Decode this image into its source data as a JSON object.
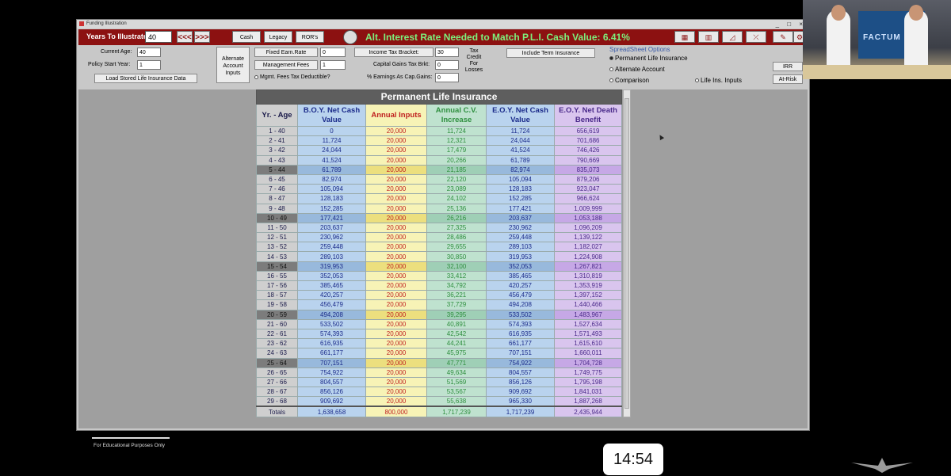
{
  "window": {
    "title": "Funding Illustration",
    "controls": "_ □ ×"
  },
  "topbar": {
    "years_label": "Years To Illustrate:",
    "years_value": "40",
    "prev_label": "<<<",
    "next_label": ">>>",
    "cash_label": "Cash",
    "legacy_label": "Legacy",
    "rors_label": "ROR's",
    "alt_rate_text": "Alt. Interest Rate Needed to Match P.L.I. Cash Value: 6.41%"
  },
  "inputs": {
    "current_age_label": "Current Age:",
    "current_age": "40",
    "policy_start_label": "Policy Start Year:",
    "policy_start": "1",
    "load_button": "Load Stored Life Insurance Data",
    "alt_inputs_button": "Alternate Account Inputs",
    "fixed_rate_label": "Fixed Earn.Rate",
    "fixed_rate": "0",
    "mgmt_fees_label": "Management Fees",
    "mgmt_fees": "1",
    "mgmt_tax_label": "Mgmt. Fees Tax Deductible?",
    "income_tax_label": "Income Tax Bracket:",
    "income_tax": "30",
    "cap_gains_label": "Capital Gains Tax Brkt:",
    "cap_gains": "0",
    "earnings_cap_label": "% Earnings As Cap.Gains:",
    "earnings_cap": "0",
    "tax_credit_label": "Tax Credit For Losses",
    "term_button": "Include Term Insurance",
    "ss_title": "SpreadSheet Options",
    "opt_pli": "Permanent Life Insurance",
    "opt_alt": "Alternate Account",
    "opt_comp": "Comparison",
    "opt_life": "Life Ins. Inputs",
    "irr_button": "IRR",
    "atrisk_button": "At-Risk"
  },
  "overlay": {
    "edu_note": "For Educational Purposes Only",
    "timer": "14:54",
    "webcam_brand": "FACTUM"
  },
  "chart_data": {
    "type": "table",
    "title": "Permanent Life Insurance",
    "columns": [
      "Yr. - Age",
      "B.O.Y. Net Cash Value",
      "Annual Inputs",
      "Annual C.V. Increase",
      "E.O.Y. Net Cash Value",
      "E.O.Y. Net Death Benefit"
    ],
    "rows": [
      [
        "1 - 40",
        "0",
        "20,000",
        "11,724",
        "11,724",
        "656,619"
      ],
      [
        "2 - 41",
        "11,724",
        "20,000",
        "12,321",
        "24,044",
        "701,686"
      ],
      [
        "3 - 42",
        "24,044",
        "20,000",
        "17,479",
        "41,524",
        "746,426"
      ],
      [
        "4 - 43",
        "41,524",
        "20,000",
        "20,266",
        "61,789",
        "790,669"
      ],
      [
        "5 - 44",
        "61,789",
        "20,000",
        "21,185",
        "82,974",
        "835,073"
      ],
      [
        "6 - 45",
        "82,974",
        "20,000",
        "22,120",
        "105,094",
        "879,206"
      ],
      [
        "7 - 46",
        "105,094",
        "20,000",
        "23,089",
        "128,183",
        "923,047"
      ],
      [
        "8 - 47",
        "128,183",
        "20,000",
        "24,102",
        "152,285",
        "966,624"
      ],
      [
        "9 - 48",
        "152,285",
        "20,000",
        "25,136",
        "177,421",
        "1,009,999"
      ],
      [
        "10 - 49",
        "177,421",
        "20,000",
        "26,216",
        "203,637",
        "1,053,188"
      ],
      [
        "11 - 50",
        "203,637",
        "20,000",
        "27,325",
        "230,962",
        "1,096,209"
      ],
      [
        "12 - 51",
        "230,962",
        "20,000",
        "28,486",
        "259,448",
        "1,139,122"
      ],
      [
        "13 - 52",
        "259,448",
        "20,000",
        "29,655",
        "289,103",
        "1,182,027"
      ],
      [
        "14 - 53",
        "289,103",
        "20,000",
        "30,850",
        "319,953",
        "1,224,908"
      ],
      [
        "15 - 54",
        "319,953",
        "20,000",
        "32,100",
        "352,053",
        "1,267,821"
      ],
      [
        "16 - 55",
        "352,053",
        "20,000",
        "33,412",
        "385,465",
        "1,310,819"
      ],
      [
        "17 - 56",
        "385,465",
        "20,000",
        "34,792",
        "420,257",
        "1,353,919"
      ],
      [
        "18 - 57",
        "420,257",
        "20,000",
        "36,221",
        "456,479",
        "1,397,152"
      ],
      [
        "19 - 58",
        "456,479",
        "20,000",
        "37,729",
        "494,208",
        "1,440,466"
      ],
      [
        "20 - 59",
        "494,208",
        "20,000",
        "39,295",
        "533,502",
        "1,483,967"
      ],
      [
        "21 - 60",
        "533,502",
        "20,000",
        "40,891",
        "574,393",
        "1,527,634"
      ],
      [
        "22 - 61",
        "574,393",
        "20,000",
        "42,542",
        "616,935",
        "1,571,493"
      ],
      [
        "23 - 62",
        "616,935",
        "20,000",
        "44,241",
        "661,177",
        "1,615,610"
      ],
      [
        "24 - 63",
        "661,177",
        "20,000",
        "45,975",
        "707,151",
        "1,660,011"
      ],
      [
        "25 - 64",
        "707,151",
        "20,000",
        "47,771",
        "754,922",
        "1,704,728"
      ],
      [
        "26 - 65",
        "754,922",
        "20,000",
        "49,634",
        "804,557",
        "1,749,775"
      ],
      [
        "27 - 66",
        "804,557",
        "20,000",
        "51,569",
        "856,126",
        "1,795,198"
      ],
      [
        "28 - 67",
        "856,126",
        "20,000",
        "53,567",
        "909,692",
        "1,841,031"
      ],
      [
        "29 - 68",
        "909,692",
        "20,000",
        "55,638",
        "965,330",
        "1,887,268"
      ]
    ],
    "highlight_every": 5,
    "totals": [
      "Totals",
      "1,638,658",
      "800,000",
      "1,717,239",
      "1,717,239",
      "2,435,944"
    ]
  }
}
